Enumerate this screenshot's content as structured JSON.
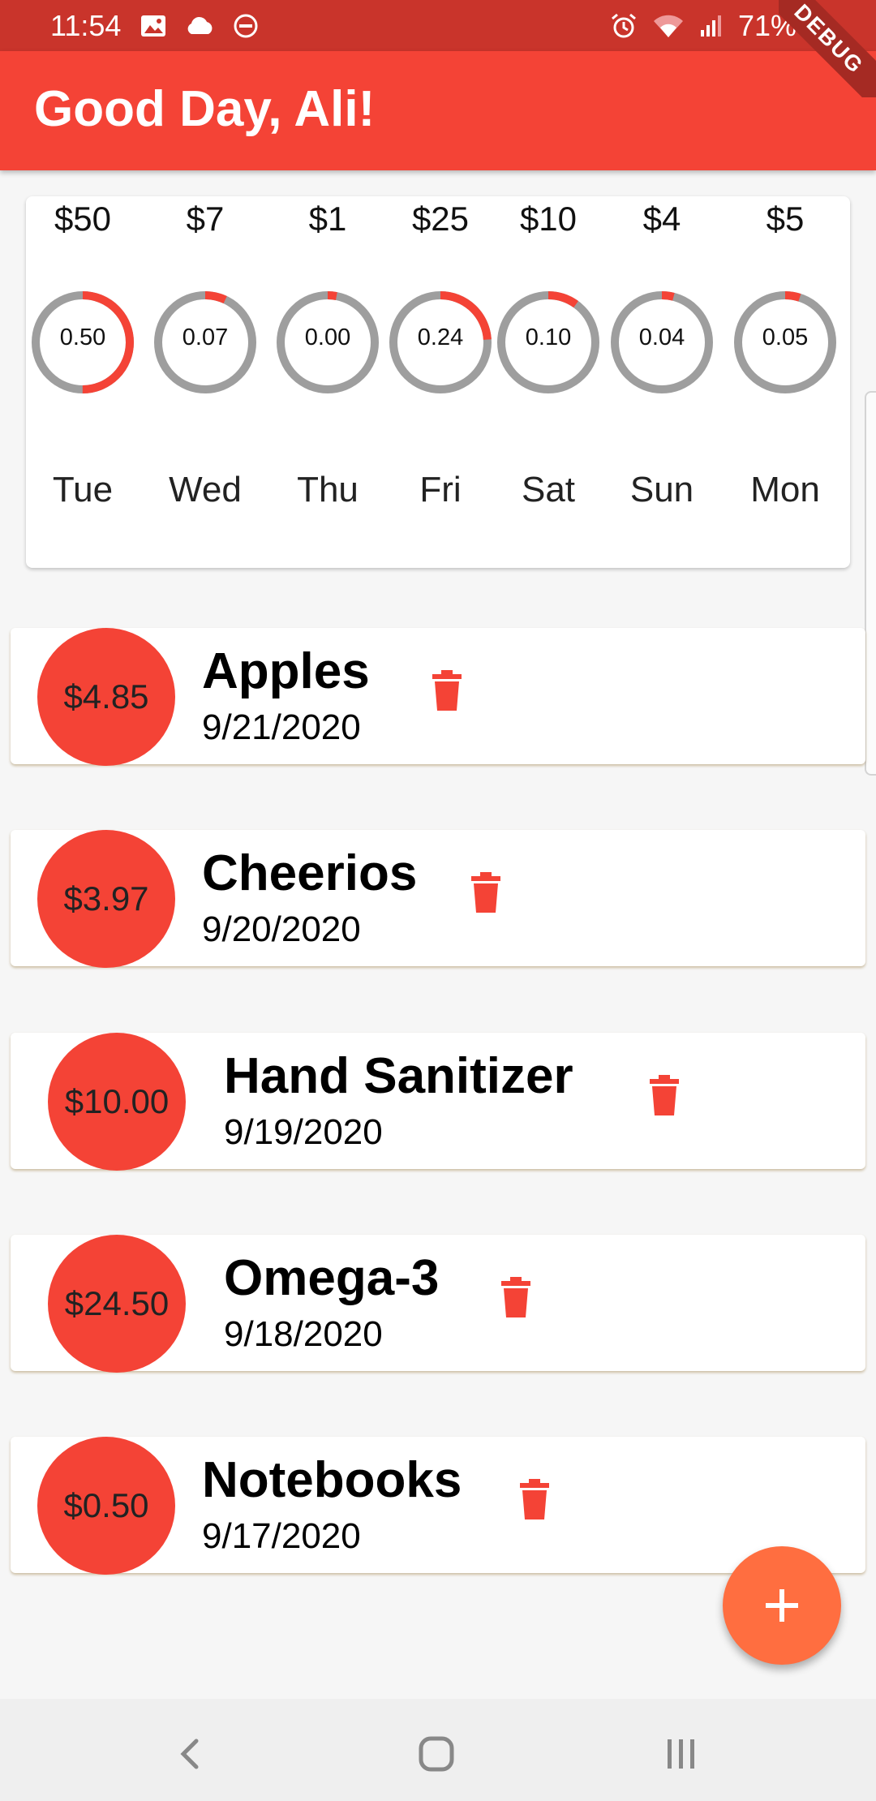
{
  "status_bar": {
    "time": "11:54",
    "battery": "71%",
    "left_icons": [
      "image-icon",
      "cloud-icon",
      "do-not-disturb-icon"
    ],
    "right_icons": [
      "alarm-icon",
      "wifi-icon",
      "signal-icon",
      "battery-icon"
    ]
  },
  "app_bar": {
    "title": "Good Day, Ali!",
    "color": "#f44336",
    "debug_banner": "DEBUG"
  },
  "weekly_chart": {
    "bars": [
      {
        "amount": "$50",
        "fraction": 0.5,
        "fraction_label": "0.50",
        "day": "Tue"
      },
      {
        "amount": "$7",
        "fraction": 0.07,
        "fraction_label": "0.07",
        "day": "Wed"
      },
      {
        "amount": "$1",
        "fraction": 0.0,
        "fraction_label": "0.00",
        "day": "Thu"
      },
      {
        "amount": "$25",
        "fraction": 0.24,
        "fraction_label": "0.24",
        "day": "Fri"
      },
      {
        "amount": "$10",
        "fraction": 0.1,
        "fraction_label": "0.10",
        "day": "Sat"
      },
      {
        "amount": "$4",
        "fraction": 0.04,
        "fraction_label": "0.04",
        "day": "Sun"
      },
      {
        "amount": "$5",
        "fraction": 0.05,
        "fraction_label": "0.05",
        "day": "Mon"
      }
    ],
    "ring_fill_color": "#f44336",
    "ring_track_color": "#9e9e9e"
  },
  "transactions": [
    {
      "amount": "$4.85",
      "title": "Apples",
      "date": "9/21/2020"
    },
    {
      "amount": "$3.97",
      "title": "Cheerios",
      "date": "9/20/2020"
    },
    {
      "amount": "$10.00",
      "title": "Hand Sanitizer",
      "date": "9/19/2020"
    },
    {
      "amount": "$24.50",
      "title": "Omega-3",
      "date": "9/18/2020"
    },
    {
      "amount": "$0.50",
      "title": "Notebooks",
      "date": "9/17/2020"
    }
  ],
  "delete_icon": "trash-icon",
  "delete_color": "#f44336",
  "fab": {
    "icon": "plus-icon",
    "color": "#ff6e40"
  },
  "nav_bar": {
    "buttons": [
      "back-icon",
      "home-icon",
      "recents-icon"
    ]
  }
}
